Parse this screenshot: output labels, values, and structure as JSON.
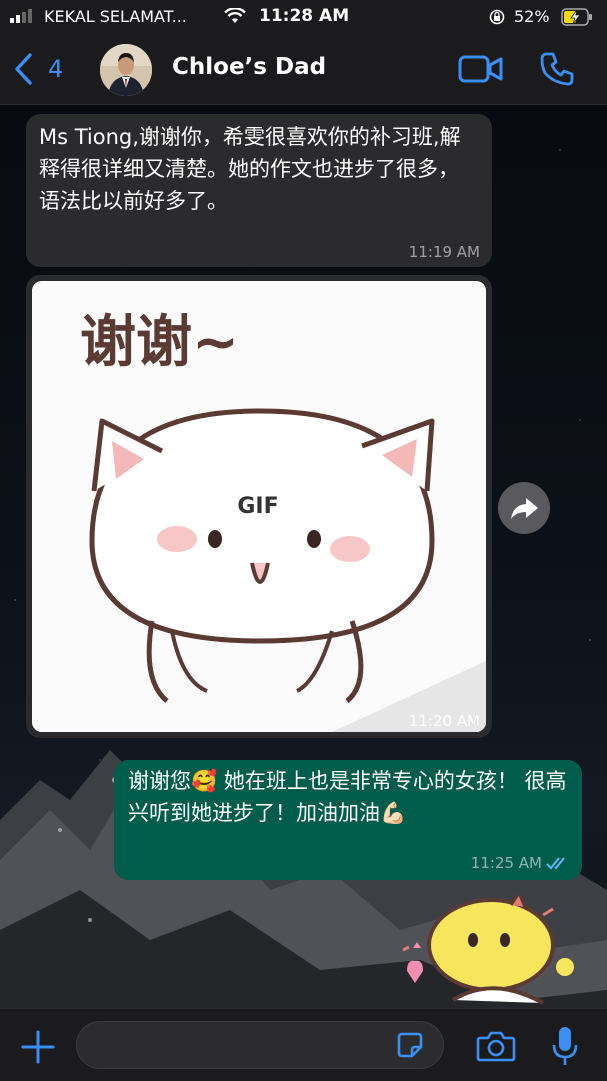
{
  "status_bar": {
    "carrier": "KEKAL SELAMAT...",
    "time": "11:28 AM",
    "battery": "52%"
  },
  "header": {
    "back_count": "4",
    "contact_name": "Chloe’s Dad"
  },
  "messages": [
    {
      "direction": "incoming",
      "text": "Ms Tiong,谢谢你，希雯很喜欢你的补习班,解释得很详细又清楚。她的作文也进步了很多，语法比以前好多了。",
      "time": "11:19 AM"
    },
    {
      "direction": "incoming",
      "type": "gif",
      "gif_caption": "谢谢~",
      "badge": "GIF",
      "time": "11:20 AM"
    },
    {
      "direction": "outgoing",
      "text": "谢谢您🥰 她在班上也是非常专心的女孩！ 很高兴听到她进步了！加油加油💪🏻",
      "time": "11:25 AM",
      "status": "read"
    }
  ],
  "composer": {
    "placeholder": ""
  },
  "colors": {
    "accent": "#3a8ff5",
    "outgoing_bubble": "#005c4b",
    "incoming_bubble": "#2b2b2e",
    "bar": "#1b1b1d"
  },
  "icons": [
    "signal-icon",
    "wifi-icon",
    "rotation-lock-icon",
    "battery-icon",
    "back-chevron-icon",
    "video-call-icon",
    "phone-icon",
    "forward-icon",
    "read-ticks-icon",
    "plus-icon",
    "sticker-icon",
    "camera-icon",
    "microphone-icon"
  ]
}
